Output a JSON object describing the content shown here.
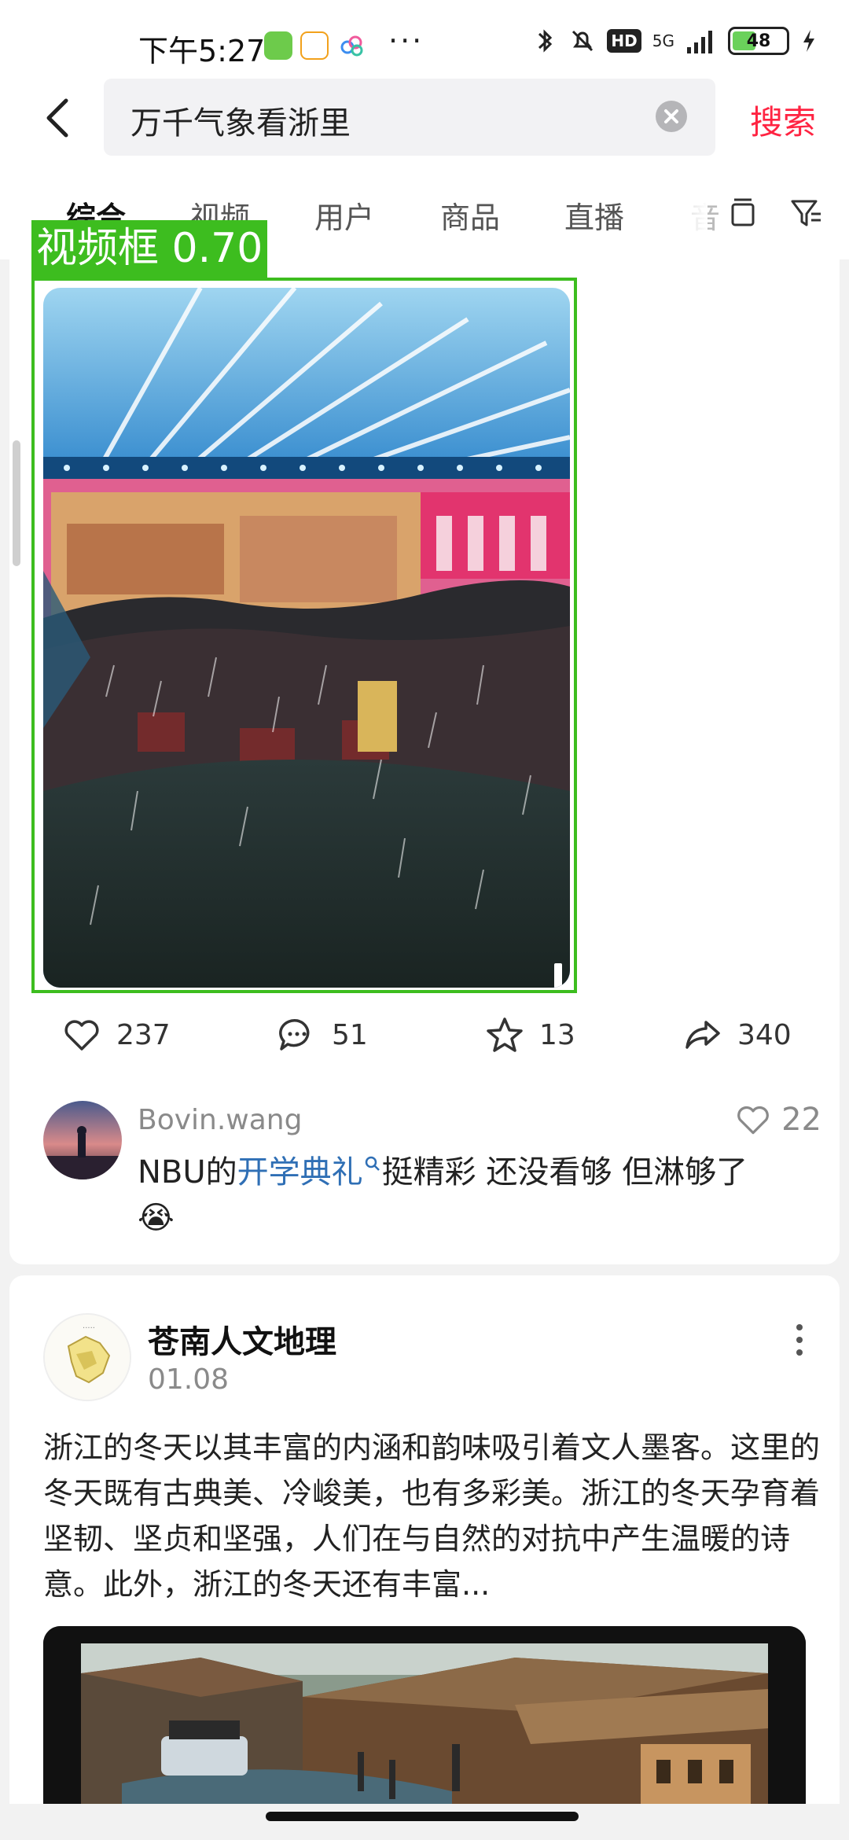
{
  "status_bar": {
    "time": "下午5:27",
    "network": "5G",
    "hd_badge": "HD",
    "battery": "48",
    "battery_level": 0.48,
    "icons": [
      "bluetooth-icon",
      "mute-icon",
      "signal-icon",
      "charging-icon"
    ]
  },
  "search": {
    "query": "万千气象看浙里",
    "search_button": "搜索"
  },
  "tabs": [
    {
      "label": "综合",
      "active": true
    },
    {
      "label": "视频",
      "active": false
    },
    {
      "label": "用户",
      "active": false
    },
    {
      "label": "商品",
      "active": false
    },
    {
      "label": "直播",
      "active": false
    },
    {
      "label": "音",
      "active": false
    }
  ],
  "detection": {
    "label": "视频框 0.70",
    "color": "#3dbd1f"
  },
  "post1": {
    "likes": "237",
    "comments": "51",
    "favorites": "13",
    "shares": "340",
    "top_comment": {
      "user": "Bovin.wang",
      "likes": "22",
      "text_before": "NBU的",
      "link": "开学典礼",
      "text_after": "挺精彩  还没看够 但淋够了",
      "emoji": "😭"
    }
  },
  "post2": {
    "author": "苍南人文地理",
    "date": "01.08",
    "text": "浙江的冬天以其丰富的内涵和韵味吸引着文人墨客。这里的冬天既有古典美、冷峻美，也有多彩美。浙江的冬天孕育着坚韧、坚贞和坚强，人们在与自然的对抗中产生温暖的诗意。此外，浙江的冬天还有丰富..."
  },
  "colors": {
    "accent": "#ff2442",
    "link": "#2f6fb5"
  }
}
